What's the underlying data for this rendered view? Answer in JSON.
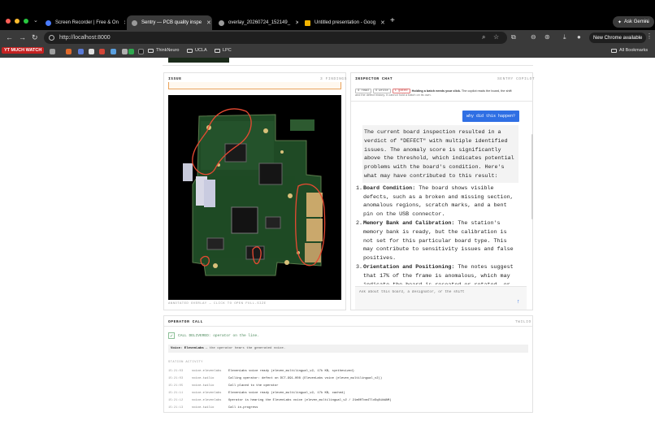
{
  "browser": {
    "tabs": [
      {
        "label": "Screen Recorder | Free & On"
      },
      {
        "label": "Sentry — PCB quality inspe"
      },
      {
        "label": "overlay_20260724_152149_"
      },
      {
        "label": "Untitled presentation - Goog"
      }
    ],
    "ask_gemini": "Ask Gemini",
    "url": "http://localhost:8000",
    "new_chrome": "New Chrome available",
    "bookmarks": {
      "ytwatch": "YT MUCH WATCH",
      "thinkneuro": "ThinkNeuro",
      "ucla": "UCLA",
      "lpc": "LPC",
      "all": "All Bookmarks"
    }
  },
  "issue": {
    "title": "ISSUE",
    "findings": "3 FINDINGS",
    "caption": "ANNOTATED OVERLAY — CLICK TO OPEN FULL-SIZE"
  },
  "chat": {
    "title": "INSPECTOR CHAT",
    "subtitle": "SENTRY COPILOT",
    "chip_read": "4 read",
    "chip_write": "4 write",
    "chip_gated": "1 gated",
    "note_bold": "Holding a batch needs your click.",
    "note_rest": "The copilot reads the board, the shift",
    "note_line2": "and the defect history. It cannot hold a batch on its own.",
    "user_message": "why did this happen?",
    "intro": "The current board inspection resulted in a verdict of \"DEFECT\" with multiple identified issues. The anomaly score is significantly above the threshold, which indicates potential problems with the board's condition. Here's what may have contributed to this result:",
    "items": [
      {
        "num": "1.",
        "title": "Board Condition:",
        "text": "The board shows visible defects, such as a broken and missing section, anomalous regions, scratch marks, and a bent pin on the USB connector."
      },
      {
        "num": "2.",
        "title": "Memory Bank and Calibration:",
        "text": "The station's memory bank is ready, but the calibration is not set for this particular board type. This may contribute to sensitivity issues and false positives."
      },
      {
        "num": "3.",
        "title": "Orientation and Positioning:",
        "text": "The notes suggest that 17% of the frame is anomalous, which may indicate the board is reseated or rotated, or"
      }
    ],
    "input_placeholder": "Ask about this board, a designator, or the shift"
  },
  "operator": {
    "title": "OPERATOR CALL",
    "meta": "TWILIO",
    "delivered": "CALL DELIVERED: operator on the line.",
    "voice_label": "Voice: ElevenLabs",
    "voice_rest": "— the operator hears the generated voice.",
    "activity_label": "STATION ACTIVITY",
    "activity": [
      {
        "time": "15:21:03",
        "source": "voice.elevenlabs",
        "message": "ElevenLabs voice ready (eleven_multilingual_v2, 17k KB, synthesized)"
      },
      {
        "time": "15:21:03",
        "source": "voice.twilio",
        "message": "Calling operator: defect on DCT-991-008 (ElevenLabs voice (eleven_multilingual_v2))"
      },
      {
        "time": "15:21:05",
        "source": "voice.twilio",
        "message": "Call placed to the operator"
      },
      {
        "time": "15:21:11",
        "source": "voice.elevenlabs",
        "message": "ElevenLabs voice ready (eleven_multilingual_v2, 17k KB, cached)"
      },
      {
        "time": "15:21:12",
        "source": "voice.elevenlabs",
        "message": "Operator is hearing the ElevenLabs voice (eleven_multilingual_v2 / 21m00Tcm4TlvDq8ikWAM)"
      },
      {
        "time": "15:21:13",
        "source": "voice.twilio",
        "message": "Call in-progress"
      }
    ]
  }
}
